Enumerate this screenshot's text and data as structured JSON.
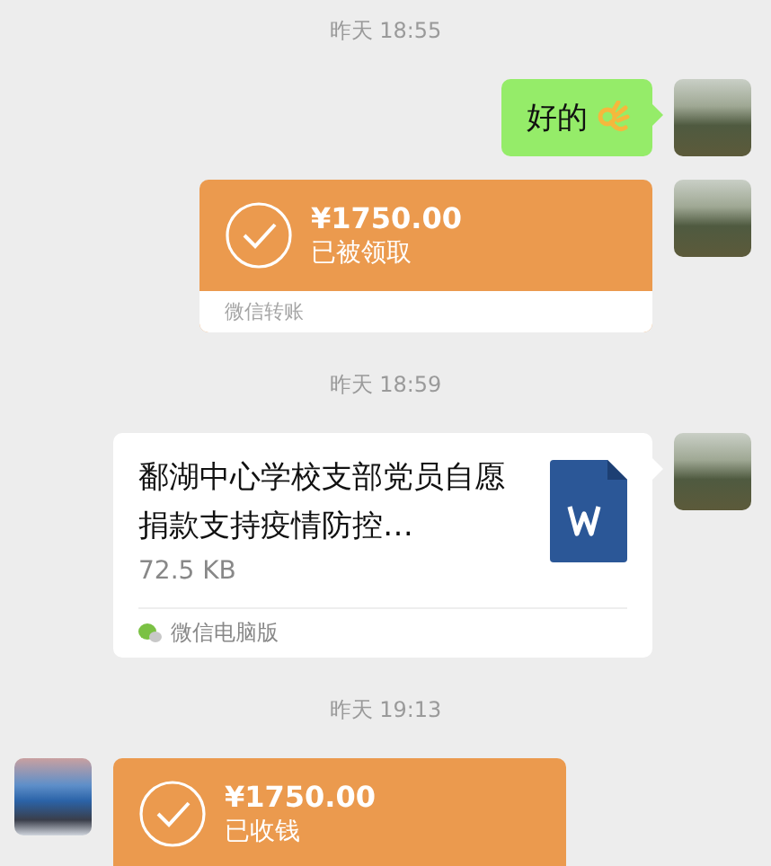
{
  "messages": [
    {
      "kind": "time",
      "text": "昨天 18:55"
    },
    {
      "kind": "text",
      "outgoing": true,
      "text": "好的"
    },
    {
      "kind": "transfer",
      "outgoing": true,
      "amount": "¥1750.00",
      "status": "已被领取",
      "footer": "微信转账"
    },
    {
      "kind": "time",
      "text": "昨天 18:59"
    },
    {
      "kind": "file",
      "outgoing": true,
      "title": "鄱湖中心学校支部党员自愿捐款支持疫情防控…",
      "size": "72.5 KB",
      "source": "微信电脑版"
    },
    {
      "kind": "time",
      "text": "昨天 19:13"
    },
    {
      "kind": "transfer",
      "outgoing": false,
      "amount": "¥1750.00",
      "status": "已收钱"
    }
  ]
}
